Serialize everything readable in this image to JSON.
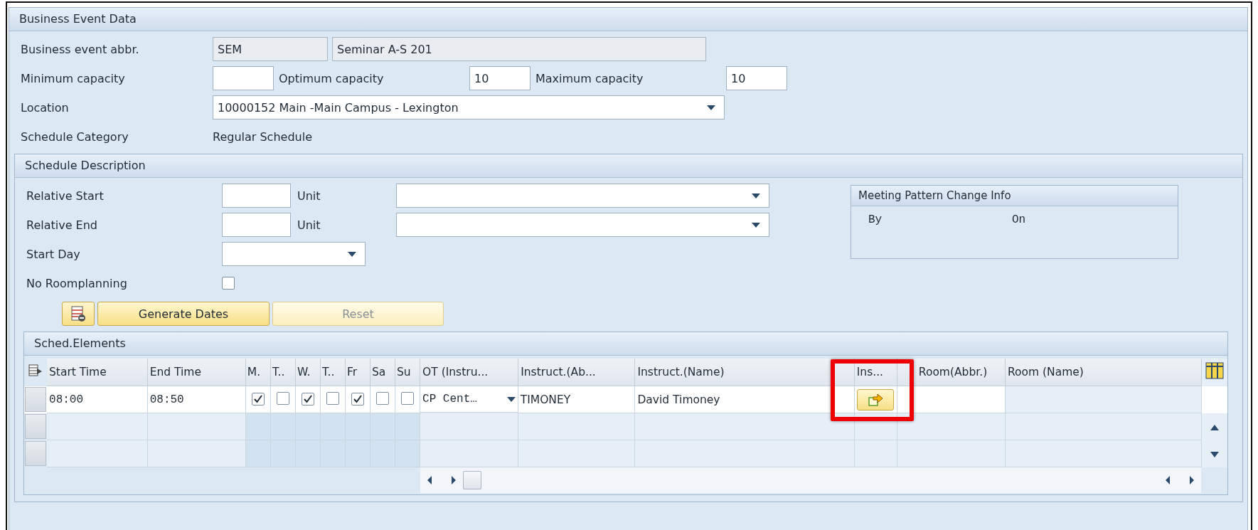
{
  "business_event_data": {
    "title": "Business Event Data",
    "event_abbr": {
      "label": "Business event abbr.",
      "value": "SEM",
      "name": "Seminar A-S 201"
    },
    "capacities": [
      {
        "label": "Minimum capacity"
      },
      {
        "label": "Optimum capacity",
        "value": "10"
      },
      {
        "label": "Maximum capacity",
        "value": "10"
      }
    ],
    "location": {
      "label": "Location",
      "value": "10000152 Main -Main Campus - Lexington"
    },
    "schedule_category": {
      "label": "Schedule Category",
      "value": "Regular Schedule"
    }
  },
  "schedule_description": {
    "title": "Schedule Description",
    "relative_rows": [
      {
        "label": "Relative Start",
        "unit_label": "Unit"
      },
      {
        "label": "Relative End",
        "unit_label": "Unit"
      }
    ],
    "start_day": {
      "label": "Start Day"
    },
    "no_roomplanning": {
      "label": "No Roomplanning",
      "checked": false
    },
    "change_info": {
      "title": "Meeting Pattern Change Info",
      "by_label": "By",
      "on_label": "On"
    },
    "buttons": [
      {
        "kind": "icon"
      },
      {
        "kind": "text",
        "label": "Generate Dates",
        "disabled": false
      },
      {
        "kind": "text",
        "label": "Reset",
        "disabled": true
      }
    ]
  },
  "sched_elements": {
    "title": "Sched.Elements",
    "columns": [
      "Start Time",
      "End Time",
      "M.",
      "T..",
      "W.",
      "T..",
      "Fr",
      "Sa",
      "Su",
      "OT (Instru...",
      "Instruct.(Ab...",
      "Instruct.(Name)",
      "Ins...",
      "Room(Abbr.)",
      "Room (Name)"
    ],
    "rows": [
      {
        "kind": "entry",
        "start_time": "08:00",
        "end_time": "08:50",
        "days": [
          true,
          false,
          true,
          false,
          true,
          false,
          false
        ],
        "ot": "CP Cent…",
        "instructor_abbr": "TIMONEY",
        "instructor_name": "David Timoney",
        "ins_highlighted": true
      },
      {
        "kind": "empty"
      },
      {
        "kind": "empty"
      }
    ]
  }
}
